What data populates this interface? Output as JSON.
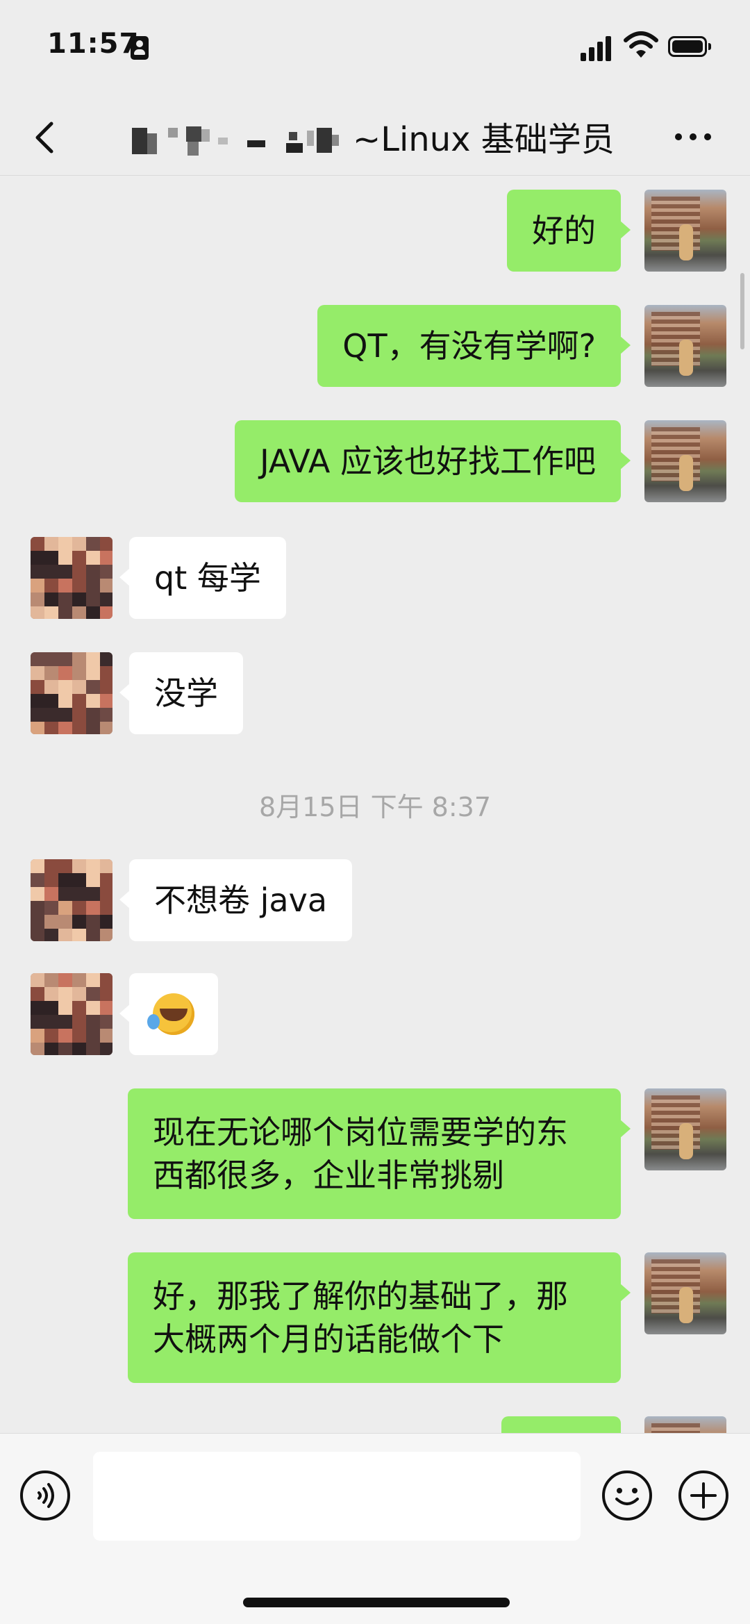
{
  "status_bar": {
    "time": "11:57"
  },
  "header": {
    "title": "~Linux 基础学员"
  },
  "messages": [
    {
      "side": "out",
      "text": "好的"
    },
    {
      "side": "out",
      "text": "QT，有没有学啊?"
    },
    {
      "side": "out",
      "text": "JAVA 应该也好找工作吧"
    },
    {
      "side": "in",
      "text": "qt 每学"
    },
    {
      "side": "in",
      "text": "没学"
    },
    {
      "side": "in",
      "text": "不想卷 java"
    },
    {
      "side": "in",
      "emoji": "facepalm-crying-emoji"
    },
    {
      "side": "out",
      "text": "现在无论哪个岗位需要学的东西都很多，企业非常挑剔"
    },
    {
      "side": "out",
      "text": "好，那我了解你的基础了，那大概两个月的话能做个下"
    }
  ],
  "divider": {
    "time": "8月15日 下午 8:37"
  },
  "input_bar": {
    "value": "",
    "placeholder": ""
  },
  "icons": [
    "back-icon",
    "more-icon",
    "voice-icon",
    "emoji-icon",
    "plus-icon",
    "wifi-icon",
    "battery-icon",
    "signal-icon"
  ],
  "colors": {
    "background": "#ededed",
    "outgoing_bubble": "#95ec69",
    "incoming_bubble": "#ffffff",
    "timestamp": "#a7a7a7"
  }
}
